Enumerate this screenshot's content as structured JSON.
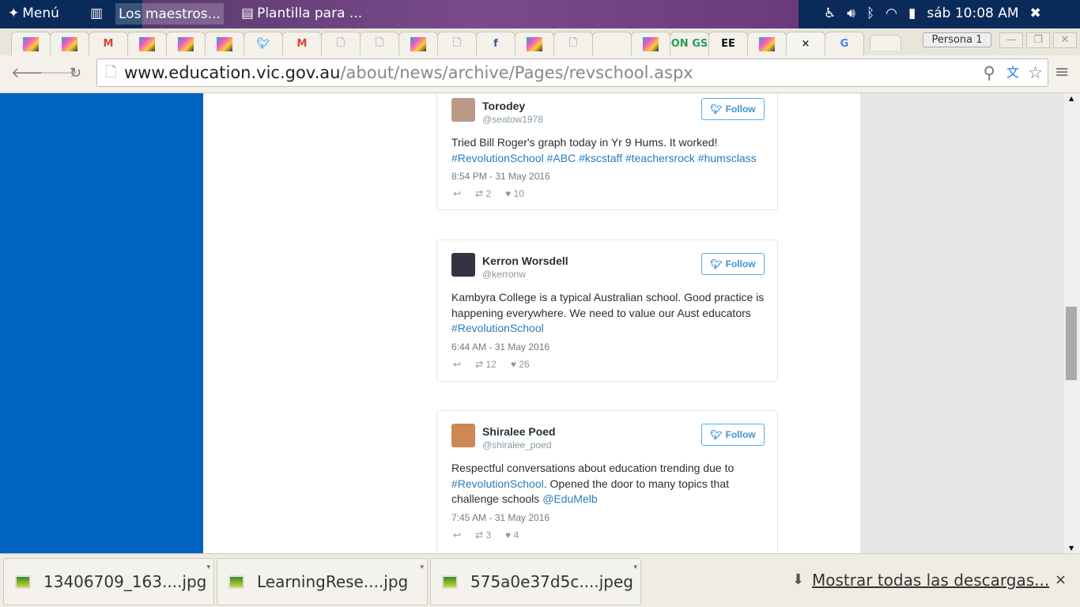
{
  "panel": {
    "menu": "Menú",
    "windows": [
      "Los maestros...",
      "Plantilla para ..."
    ],
    "clock": "sáb 10:08 AM"
  },
  "tabs": [
    {
      "icon": "app-icon"
    },
    {
      "icon": "app-icon"
    },
    {
      "icon": "gmail-icon",
      "label": "M"
    },
    {
      "icon": "app-icon"
    },
    {
      "icon": "app-icon"
    },
    {
      "icon": "app-icon"
    },
    {
      "icon": "twitter-icon"
    },
    {
      "icon": "gmail-icon",
      "label": "M"
    },
    {
      "icon": "page-icon"
    },
    {
      "icon": "page-icon"
    },
    {
      "icon": "app-icon"
    },
    {
      "icon": "page-icon"
    },
    {
      "icon": "facebook-icon",
      "label": "f"
    },
    {
      "icon": "app-icon"
    },
    {
      "icon": "page-icon"
    },
    {
      "icon": "blank"
    },
    {
      "icon": "app-icon"
    },
    {
      "icon": "ongs-icon",
      "label": "ON GS"
    },
    {
      "icon": "ee-icon",
      "label": "EE"
    },
    {
      "icon": "app-icon"
    },
    {
      "icon": "close-icon",
      "label": "×"
    },
    {
      "icon": "google-icon",
      "label": "G"
    }
  ],
  "persona": "Persona 1",
  "url": {
    "host": "www.education.vic.gov.au",
    "path": "/about/news/archive/Pages/revschool.aspx"
  },
  "tweets": [
    {
      "name": "Torodey",
      "handle": "@seatow1978",
      "follow": "Follow",
      "text": "Tried Bill Roger's graph today in Yr 9 Hums. It worked! ",
      "links": "#RevolutionSchool #ABC #kscstaff #teachersrock #humsclass",
      "text_after": "",
      "time": "8:54 PM - 31 May 2016",
      "retweets": "2",
      "likes": "10"
    },
    {
      "name": "Kerron Worsdell",
      "handle": "@kerronw",
      "follow": "Follow",
      "text": "Kambyra College is a typical Australian school. Good practice is happening everywhere. We need to value our Aust educators ",
      "links": "#RevolutionSchool",
      "text_after": "",
      "time": "6:44 AM - 31 May 2016",
      "retweets": "12",
      "likes": "26"
    },
    {
      "name": "Shiralee Poed",
      "handle": "@shiralee_poed",
      "follow": "Follow",
      "text": "Respectful conversations about education trending due to ",
      "links": "#RevolutionSchool",
      "text_after": ". Opened the door to many topics that challenge schools ",
      "mention": "@EduMelb",
      "time": "7:45 AM - 31 May 2016",
      "retweets": "3",
      "likes": "4"
    }
  ],
  "downloads": {
    "items": [
      "13406709_163....jpg",
      "LearningRese....jpg",
      "575a0e37d5c....jpeg"
    ],
    "show_all": "Mostrar todas las descargas...",
    "close": "×"
  }
}
